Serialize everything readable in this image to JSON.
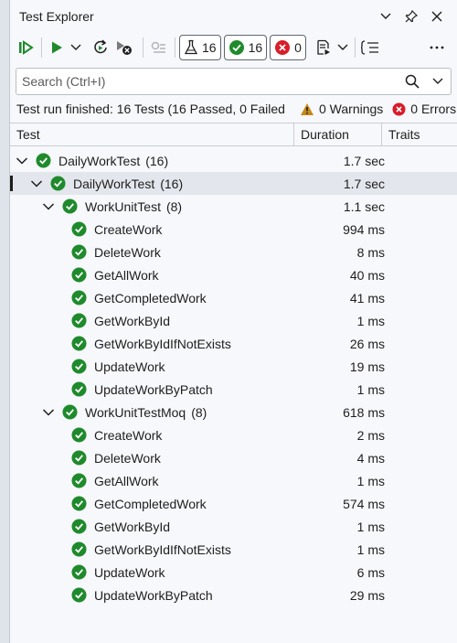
{
  "window": {
    "title": "Test Explorer"
  },
  "toolbar": {
    "counts": {
      "total": "16",
      "passed": "16",
      "failed": "0"
    }
  },
  "search": {
    "placeholder": "Search (Ctrl+I)"
  },
  "status": {
    "message": "Test run finished: 16 Tests (16 Passed, 0 Failed",
    "warnings": "0 Warnings",
    "errors": "0 Errors"
  },
  "columns": {
    "test": "Test",
    "duration": "Duration",
    "traits": "Traits"
  },
  "colors": {
    "pass": "#1f8a2c",
    "fail": "#d81e29",
    "warn": "#c7881a"
  },
  "tree": [
    {
      "name": "DailyWorkTest",
      "count": "(16)",
      "duration": "1.7 sec",
      "level": 0,
      "expandable": true
    },
    {
      "name": "DailyWorkTest",
      "count": "(16)",
      "duration": "1.7 sec",
      "level": 1,
      "expandable": true,
      "selected": true
    },
    {
      "name": "WorkUnitTest",
      "count": "(8)",
      "duration": "1.1 sec",
      "level": 2,
      "expandable": true
    },
    {
      "name": "CreateWork",
      "count": "",
      "duration": "994 ms",
      "level": 3
    },
    {
      "name": "DeleteWork",
      "count": "",
      "duration": "8 ms",
      "level": 3
    },
    {
      "name": "GetAllWork",
      "count": "",
      "duration": "40 ms",
      "level": 3
    },
    {
      "name": "GetCompletedWork",
      "count": "",
      "duration": "41 ms",
      "level": 3
    },
    {
      "name": "GetWorkById",
      "count": "",
      "duration": "1 ms",
      "level": 3
    },
    {
      "name": "GetWorkByIdIfNotExists",
      "count": "",
      "duration": "26 ms",
      "level": 3
    },
    {
      "name": "UpdateWork",
      "count": "",
      "duration": "19 ms",
      "level": 3
    },
    {
      "name": "UpdateWorkByPatch",
      "count": "",
      "duration": "1 ms",
      "level": 3
    },
    {
      "name": "WorkUnitTestMoq",
      "count": "(8)",
      "duration": "618 ms",
      "level": 2,
      "expandable": true
    },
    {
      "name": "CreateWork",
      "count": "",
      "duration": "2 ms",
      "level": 3
    },
    {
      "name": "DeleteWork",
      "count": "",
      "duration": "4 ms",
      "level": 3
    },
    {
      "name": "GetAllWork",
      "count": "",
      "duration": "1 ms",
      "level": 3
    },
    {
      "name": "GetCompletedWork",
      "count": "",
      "duration": "574 ms",
      "level": 3
    },
    {
      "name": "GetWorkById",
      "count": "",
      "duration": "1 ms",
      "level": 3
    },
    {
      "name": "GetWorkByIdIfNotExists",
      "count": "",
      "duration": "1 ms",
      "level": 3
    },
    {
      "name": "UpdateWork",
      "count": "",
      "duration": "6 ms",
      "level": 3
    },
    {
      "name": "UpdateWorkByPatch",
      "count": "",
      "duration": "29 ms",
      "level": 3
    }
  ]
}
